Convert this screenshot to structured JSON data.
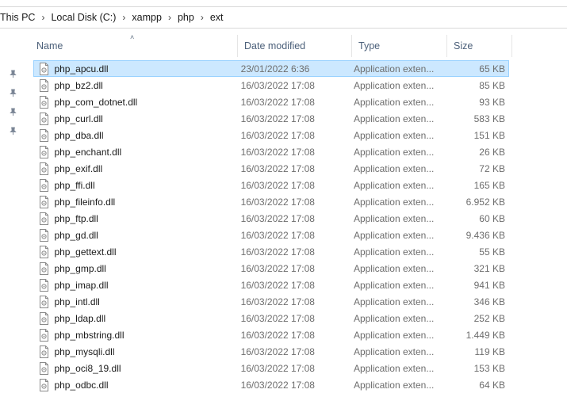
{
  "breadcrumb": [
    "This PC",
    "Local Disk (C:)",
    "xampp",
    "php",
    "ext"
  ],
  "columns": {
    "name": "Name",
    "date": "Date modified",
    "type": "Type",
    "size": "Size"
  },
  "files": [
    {
      "name": "php_apcu.dll",
      "date": "23/01/2022 6:36",
      "type": "Application exten...",
      "size": "65 KB",
      "selected": true
    },
    {
      "name": "php_bz2.dll",
      "date": "16/03/2022 17:08",
      "type": "Application exten...",
      "size": "85 KB"
    },
    {
      "name": "php_com_dotnet.dll",
      "date": "16/03/2022 17:08",
      "type": "Application exten...",
      "size": "93 KB"
    },
    {
      "name": "php_curl.dll",
      "date": "16/03/2022 17:08",
      "type": "Application exten...",
      "size": "583 KB"
    },
    {
      "name": "php_dba.dll",
      "date": "16/03/2022 17:08",
      "type": "Application exten...",
      "size": "151 KB"
    },
    {
      "name": "php_enchant.dll",
      "date": "16/03/2022 17:08",
      "type": "Application exten...",
      "size": "26 KB"
    },
    {
      "name": "php_exif.dll",
      "date": "16/03/2022 17:08",
      "type": "Application exten...",
      "size": "72 KB"
    },
    {
      "name": "php_ffi.dll",
      "date": "16/03/2022 17:08",
      "type": "Application exten...",
      "size": "165 KB"
    },
    {
      "name": "php_fileinfo.dll",
      "date": "16/03/2022 17:08",
      "type": "Application exten...",
      "size": "6.952 KB"
    },
    {
      "name": "php_ftp.dll",
      "date": "16/03/2022 17:08",
      "type": "Application exten...",
      "size": "60 KB"
    },
    {
      "name": "php_gd.dll",
      "date": "16/03/2022 17:08",
      "type": "Application exten...",
      "size": "9.436 KB"
    },
    {
      "name": "php_gettext.dll",
      "date": "16/03/2022 17:08",
      "type": "Application exten...",
      "size": "55 KB"
    },
    {
      "name": "php_gmp.dll",
      "date": "16/03/2022 17:08",
      "type": "Application exten...",
      "size": "321 KB"
    },
    {
      "name": "php_imap.dll",
      "date": "16/03/2022 17:08",
      "type": "Application exten...",
      "size": "941 KB"
    },
    {
      "name": "php_intl.dll",
      "date": "16/03/2022 17:08",
      "type": "Application exten...",
      "size": "346 KB"
    },
    {
      "name": "php_ldap.dll",
      "date": "16/03/2022 17:08",
      "type": "Application exten...",
      "size": "252 KB"
    },
    {
      "name": "php_mbstring.dll",
      "date": "16/03/2022 17:08",
      "type": "Application exten...",
      "size": "1.449 KB"
    },
    {
      "name": "php_mysqli.dll",
      "date": "16/03/2022 17:08",
      "type": "Application exten...",
      "size": "119 KB"
    },
    {
      "name": "php_oci8_19.dll",
      "date": "16/03/2022 17:08",
      "type": "Application exten...",
      "size": "153 KB"
    },
    {
      "name": "php_odbc.dll",
      "date": "16/03/2022 17:08",
      "type": "Application exten...",
      "size": "64 KB"
    }
  ],
  "icons": {
    "file": "dll-file-icon",
    "pin": "pin-icon",
    "sort": "sort-ascending-icon"
  },
  "colors": {
    "selection_bg": "#cce8ff",
    "selection_border": "#99d1ff",
    "header_text": "#4c607a"
  }
}
